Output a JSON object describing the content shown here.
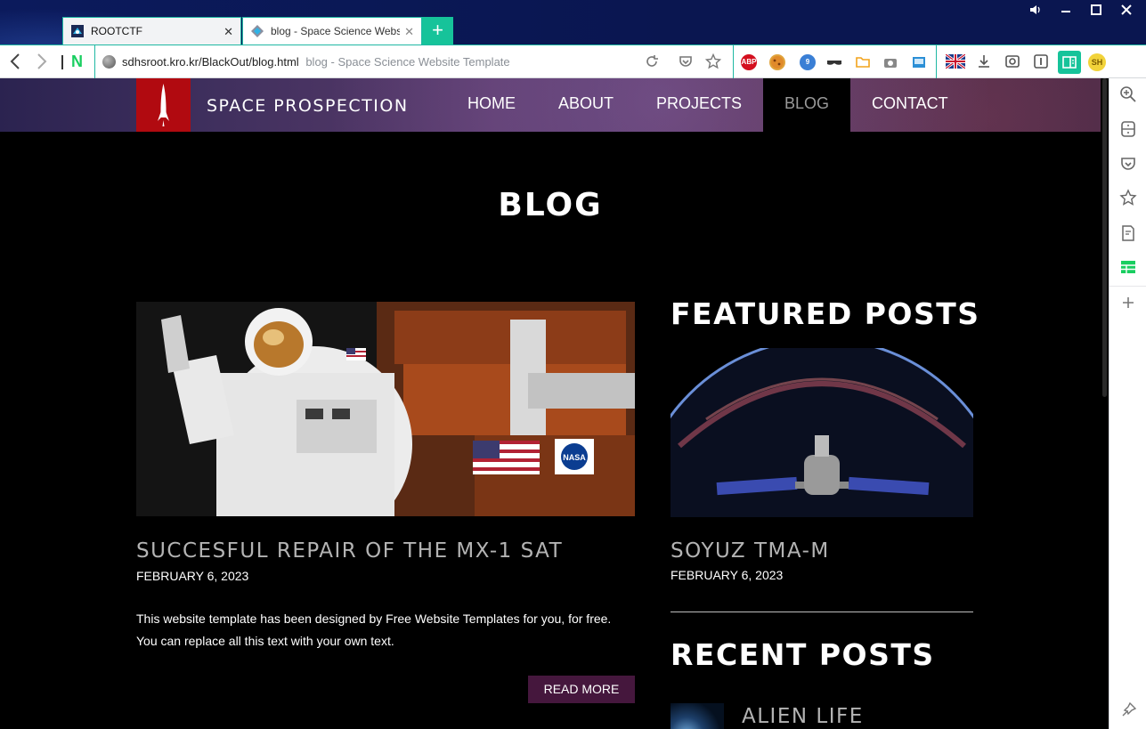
{
  "browser": {
    "tabs": [
      {
        "title": "ROOTCTF",
        "active": false
      },
      {
        "title": "blog - Space Science Website Template",
        "active": true
      }
    ],
    "new_tab_label": "+",
    "address": {
      "url": "sdhsroot.kro.kr/BlackOut/blog.html",
      "page_title": "blog - Space Science Website Template"
    },
    "naver_label": "N",
    "extensions": [
      {
        "name": "adblock-plus-icon",
        "label": "ABP",
        "color": "#d4101f"
      },
      {
        "name": "cookie-icon",
        "label": "",
        "color": "#e0a33b"
      },
      {
        "name": "globe-9-icon",
        "label": "9",
        "color": "#3a7fd5"
      },
      {
        "name": "mask-icon",
        "label": "",
        "color": "#444444"
      },
      {
        "name": "folder-icon",
        "label": "",
        "color": "#f2a31c"
      },
      {
        "name": "camera-icon",
        "label": "",
        "color": "#777777"
      },
      {
        "name": "photo-icon",
        "label": "",
        "color": "#2b8fd6"
      },
      {
        "name": "uk-flag-icon",
        "label": "",
        "color": "#1a3a8a"
      },
      {
        "name": "download-icon",
        "label": "",
        "color": "#555555"
      },
      {
        "name": "capture-icon",
        "label": "",
        "color": "#555555"
      },
      {
        "name": "reader-icon",
        "label": "",
        "color": "#555555"
      },
      {
        "name": "sidebar-toggle-icon",
        "label": "",
        "color": "#16c39a"
      },
      {
        "name": "profile-avatar",
        "label": "SH",
        "color": "#f2d33a"
      }
    ]
  },
  "site": {
    "logo_text": "SPACE PROSPECTION",
    "nav": [
      {
        "label": "HOME",
        "active": false
      },
      {
        "label": "ABOUT",
        "active": false
      },
      {
        "label": "PROJECTS",
        "active": false
      },
      {
        "label": "BLOG",
        "active": true
      },
      {
        "label": "CONTACT",
        "active": false
      }
    ],
    "page_title": "BLOG",
    "post": {
      "title": "SUCCESFUL REPAIR OF THE MX-1 SAT",
      "date": "FEBRUARY 6, 2023",
      "body_line1": "This website template has been designed by Free Website Templates for you, for free.",
      "body_line2": "You can replace all this text with your own text.",
      "read_more": "READ MORE",
      "image_badge": "NASA"
    },
    "featured": {
      "heading": "FEATURED POSTS",
      "title": "SOYUZ TMA-M",
      "date": "FEBRUARY 6, 2023"
    },
    "recent": {
      "heading": "RECENT POSTS",
      "first_title": "ALIEN LIFE"
    }
  }
}
